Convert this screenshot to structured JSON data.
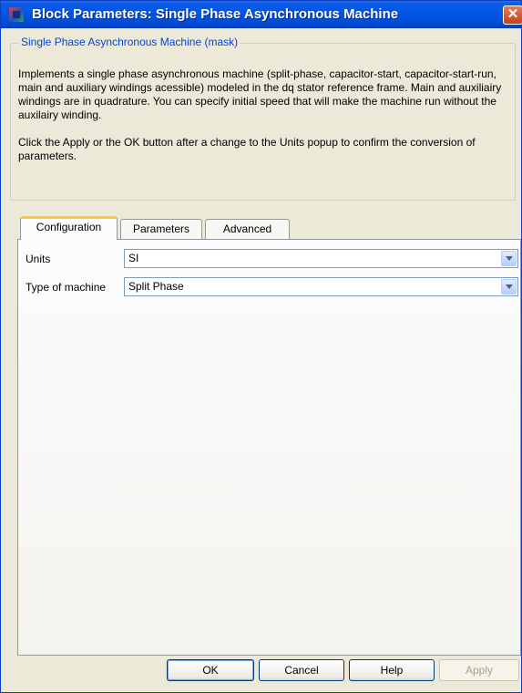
{
  "window": {
    "title": "Block Parameters: Single Phase Asynchronous Machine",
    "close_label": "✕"
  },
  "mask": {
    "group_title": "Single Phase Asynchronous Machine (mask)",
    "description_1": "Implements a single phase asynchronous machine (split-phase, capacitor-start, capacitor-start-run,  main and auxiliary windings acessible) modeled in the dq stator reference frame. Main and auxiliairy windings are in quadrature. You can specify initial speed that will make the machine run without the auxilairy winding.",
    "description_2": "Click the Apply or the OK button after a change to the Units popup to confirm the conversion of parameters."
  },
  "tabs": [
    {
      "label": "Configuration",
      "active": true
    },
    {
      "label": "Parameters",
      "active": false
    },
    {
      "label": "Advanced",
      "active": false
    }
  ],
  "config": {
    "units_label": "Units",
    "units_value": "SI",
    "machine_label": "Type of machine",
    "machine_value": "Split Phase"
  },
  "buttons": {
    "ok": "OK",
    "cancel": "Cancel",
    "help": "Help",
    "apply": "Apply"
  },
  "colors": {
    "titlebar": "#0055e5",
    "active_tab_accent": "#ffc73c",
    "group_title": "#0046d5"
  }
}
